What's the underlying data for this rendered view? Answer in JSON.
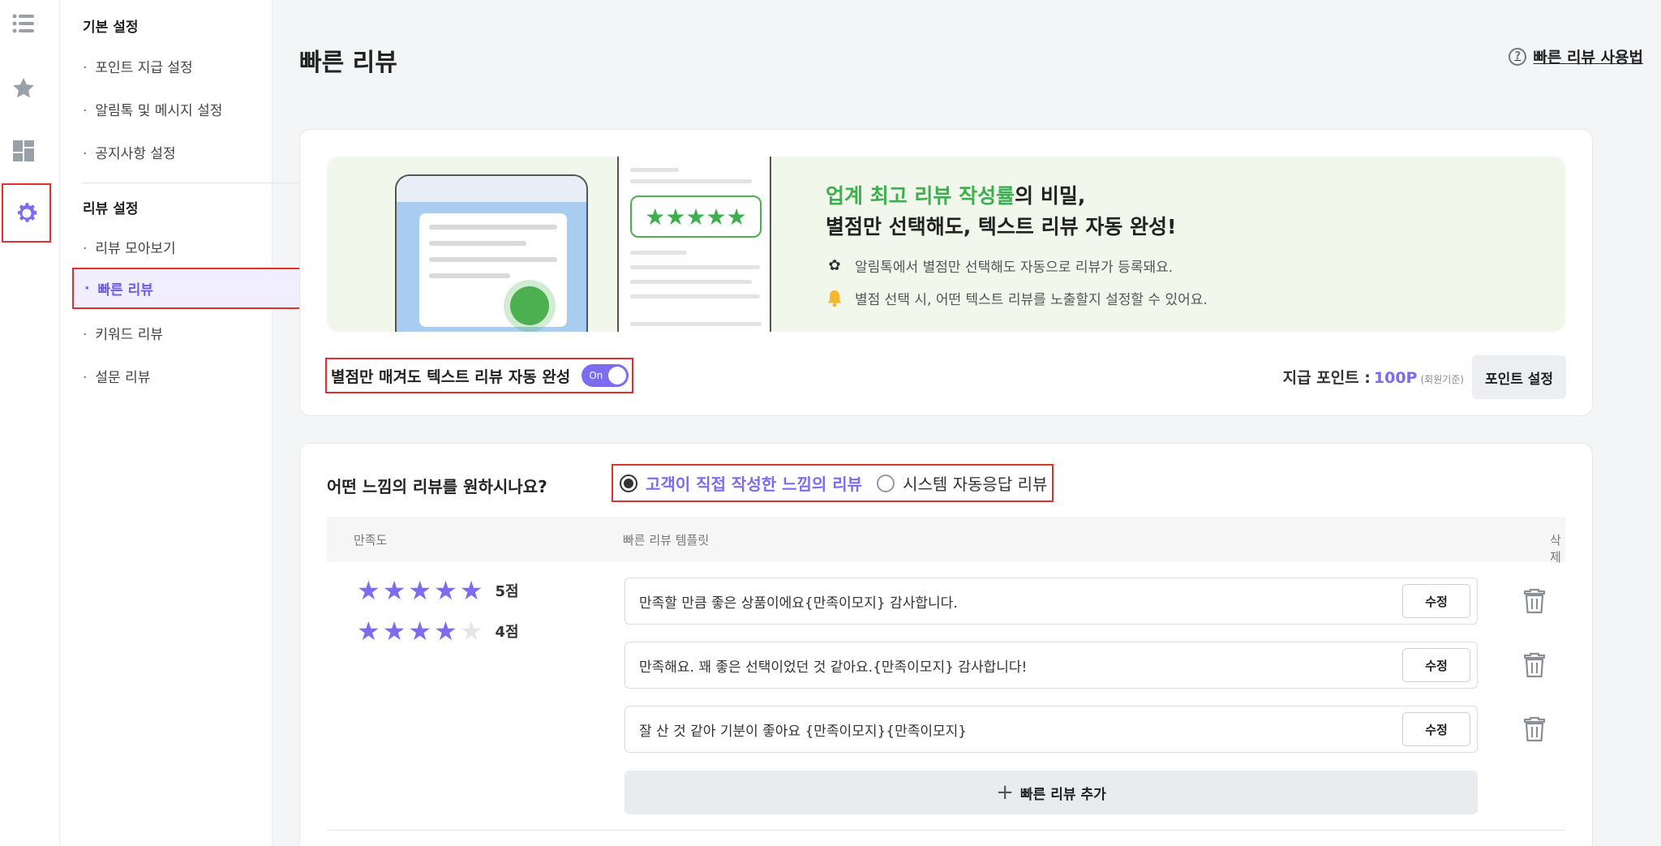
{
  "submenu": {
    "basic_heading": "기본 설정",
    "basic_items": [
      "포인트 지급 설정",
      "알림톡 및 메시지 설정",
      "공지사항 설정"
    ],
    "review_heading": "리뷰 설정",
    "review_items": [
      "리뷰 모아보기",
      "빠른 리뷰",
      "키워드 리뷰",
      "설문 리뷰"
    ]
  },
  "rail": {
    "icons": [
      "list-icon",
      "star-icon",
      "dashboard-icon",
      "gear-icon"
    ],
    "active": "gear-icon"
  },
  "header": {
    "title": "빠른 리뷰",
    "help_label": "빠른 리뷰 사용법",
    "help_icon": "?"
  },
  "banner": {
    "headline_highlight": "업계 최고 리뷰 작성률",
    "headline_rest": "의 비밀,",
    "headline_line2": "별점만 선택해도, 텍스트 리뷰 자동 완성!",
    "bullet1": "알림톡에서 별점만 선택해도 자동으로 리뷰가 등록돼요.",
    "bullet2": "별점 선택 시, 어떤 텍스트 리뷰를 노출할지 설정할 수 있어요.",
    "star_glyphs": "★★★★★",
    "accent_color": "#3fae4f"
  },
  "auto_complete": {
    "label": "별점만 매겨도 텍스트 리뷰 자동 완성",
    "toggle_state": "On",
    "points_label": "지급 포인트 :",
    "points_value": "100P",
    "points_note": "(회원기준)",
    "points_button": "포인트 설정"
  },
  "review_type": {
    "question": "어떤 느낌의 리뷰를 원하시나요?",
    "options": [
      "고객이 직접 작성한 느낌의 리뷰",
      "시스템 자동응답 리뷰"
    ],
    "selected": "고객이 직접 작성한 느낌의 리뷰"
  },
  "table": {
    "headers": [
      "만족도",
      "빠른 리뷰 템플릿",
      "삭제"
    ],
    "ratings": [
      {
        "stars": 5,
        "score_label": "5점"
      },
      {
        "stars": 4,
        "score_label": "4점"
      }
    ],
    "templates": [
      "만족할 만큼 좋은 상품이에요{만족이모지} 감사합니다.",
      "만족해요. 꽤 좋은 선택이었던 것 같아요.{만족이모지} 감사합니다!",
      "잘 산 것 같아 기분이 좋아요 {만족이모지}{만족이모지}"
    ],
    "edit_label": "수정",
    "add_label": "빠른 리뷰 추가",
    "add_icon": "+"
  },
  "colors": {
    "accent": "#7b6cf0",
    "highlight_border": "#e03131",
    "banner_bg": "#f2f7ec"
  }
}
